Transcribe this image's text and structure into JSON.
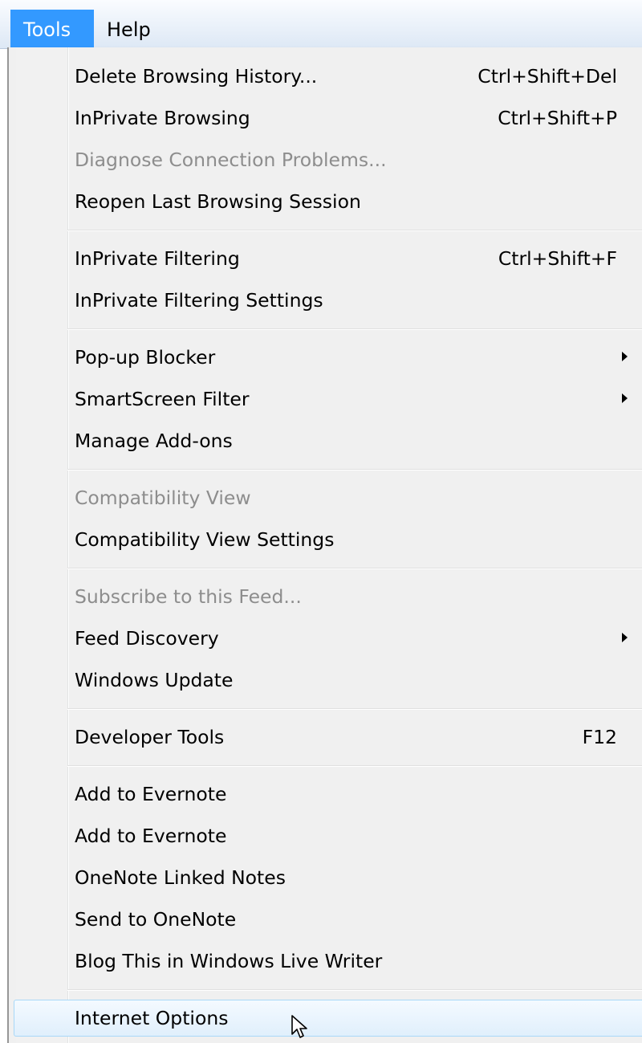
{
  "menubar": {
    "items": [
      {
        "label": "Tools",
        "active": true
      },
      {
        "label": "Help",
        "active": false
      }
    ]
  },
  "menu": {
    "groups": [
      [
        {
          "label": "Delete Browsing History...",
          "shortcut": "Ctrl+Shift+Del"
        },
        {
          "label": "InPrivate Browsing",
          "shortcut": "Ctrl+Shift+P"
        },
        {
          "label": "Diagnose Connection Problems...",
          "disabled": true
        },
        {
          "label": "Reopen Last Browsing Session"
        }
      ],
      [
        {
          "label": "InPrivate Filtering",
          "shortcut": "Ctrl+Shift+F"
        },
        {
          "label": "InPrivate Filtering Settings"
        }
      ],
      [
        {
          "label": "Pop-up Blocker",
          "submenu": true
        },
        {
          "label": "SmartScreen Filter",
          "submenu": true
        },
        {
          "label": "Manage Add-ons"
        }
      ],
      [
        {
          "label": "Compatibility View",
          "disabled": true
        },
        {
          "label": "Compatibility View Settings"
        }
      ],
      [
        {
          "label": "Subscribe to this Feed...",
          "disabled": true
        },
        {
          "label": "Feed Discovery",
          "submenu": true
        },
        {
          "label": "Windows Update"
        }
      ],
      [
        {
          "label": "Developer Tools",
          "shortcut": "F12"
        }
      ],
      [
        {
          "label": "Add to Evernote"
        },
        {
          "label": "Add to Evernote"
        },
        {
          "label": "OneNote Linked Notes"
        },
        {
          "label": "Send to OneNote"
        },
        {
          "label": "Blog This in Windows Live Writer"
        }
      ],
      [
        {
          "label": "Internet Options",
          "hover": true
        }
      ]
    ]
  },
  "cursor": {
    "icon": "arrow-cursor-icon"
  },
  "colors": {
    "menubar_active": "#3399ff",
    "disabled_text": "#8d8d8d",
    "hover_border": "#a8d8f8"
  }
}
